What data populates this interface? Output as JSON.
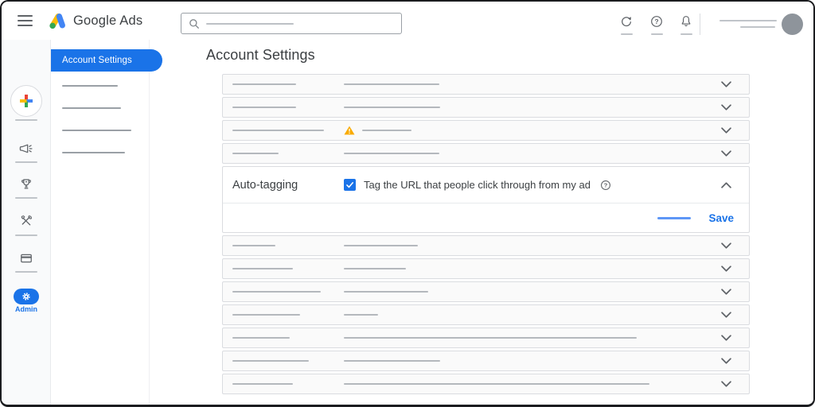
{
  "topbar": {
    "app_name": "Google Ads",
    "search": {
      "value": "",
      "placeholder_skeleton_w": 110
    },
    "actions": [
      "refresh",
      "help",
      "notifications"
    ],
    "account": {
      "line1_w": 72,
      "line2_w": 44
    }
  },
  "glyphs": {
    "question_mark": "?"
  },
  "nav_rail": {
    "items": [
      "create",
      "campaigns",
      "goals",
      "tools",
      "billing",
      "admin"
    ],
    "active_item": "admin",
    "admin_label": "Admin"
  },
  "sidebar": {
    "active_item": "Account Settings",
    "skeleton_items": [
      70,
      74,
      87,
      79
    ]
  },
  "main": {
    "title": "Account Settings",
    "rows_above": [
      {
        "label_w": 80,
        "value_w": 120
      },
      {
        "label_w": 80,
        "value_w": 121
      },
      {
        "label_w": 115,
        "value_w": 62,
        "warning": true
      },
      {
        "label_w": 58,
        "value_w": 120
      }
    ],
    "expanded_row": {
      "label": "Auto-tagging",
      "checkbox_checked": true,
      "checkbox_label": "Tag the URL that people click through from my ad",
      "save_label": "Save",
      "cancel_skeleton_w": 42
    },
    "rows_below": [
      {
        "label_w": 54,
        "value_w": 93
      },
      {
        "label_w": 76,
        "value_w": 78
      },
      {
        "label_w": 111,
        "value_w": 106
      },
      {
        "label_w": 85,
        "value_w": 43
      },
      {
        "label_w": 72,
        "value_w": 368
      },
      {
        "label_w": 96,
        "value_w": 121
      },
      {
        "label_w": 76,
        "value_w": 384
      }
    ]
  },
  "colors": {
    "accent_blue": "#1a73e8",
    "warning_yellow": "#f9ab00",
    "border_gray": "#dadce0",
    "row_bg": "#fafafa"
  }
}
